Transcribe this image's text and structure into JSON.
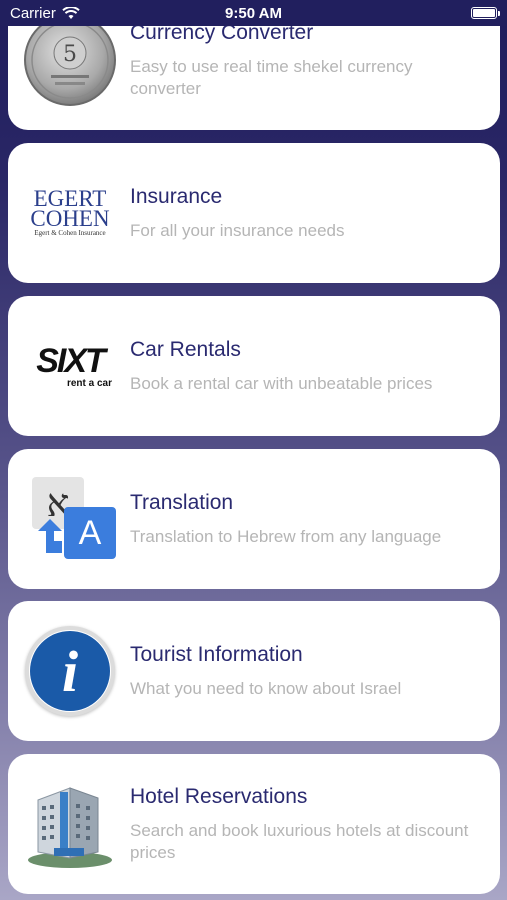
{
  "status_bar": {
    "carrier": "Carrier",
    "time": "9:50 AM"
  },
  "items": [
    {
      "title": "Currency Converter",
      "subtitle": "Easy to use real time shekel currency converter",
      "icon": "shekel-coin-icon",
      "icon_text": "5"
    },
    {
      "title": "Insurance",
      "subtitle": "For all your insurance needs",
      "icon": "egert-cohen-logo",
      "logo_line1": "EGERT",
      "logo_line2": "COHEN",
      "logo_small": "Egert & Cohen Insurance"
    },
    {
      "title": "Car Rentals",
      "subtitle": "Book a rental car with unbeatable prices",
      "icon": "sixt-logo",
      "logo_text": "SIXT",
      "logo_small": "rent a car"
    },
    {
      "title": "Translation",
      "subtitle": "Translation to Hebrew from any language",
      "icon": "translate-icon",
      "glyph_a": "א",
      "glyph_b": "A"
    },
    {
      "title": "Tourist Information",
      "subtitle": "What you need to know about Israel",
      "icon": "info-icon",
      "glyph": "i"
    },
    {
      "title": "Hotel Reservations",
      "subtitle": "Search and book luxurious hotels at discount prices",
      "icon": "hotel-building-icon"
    }
  ]
}
